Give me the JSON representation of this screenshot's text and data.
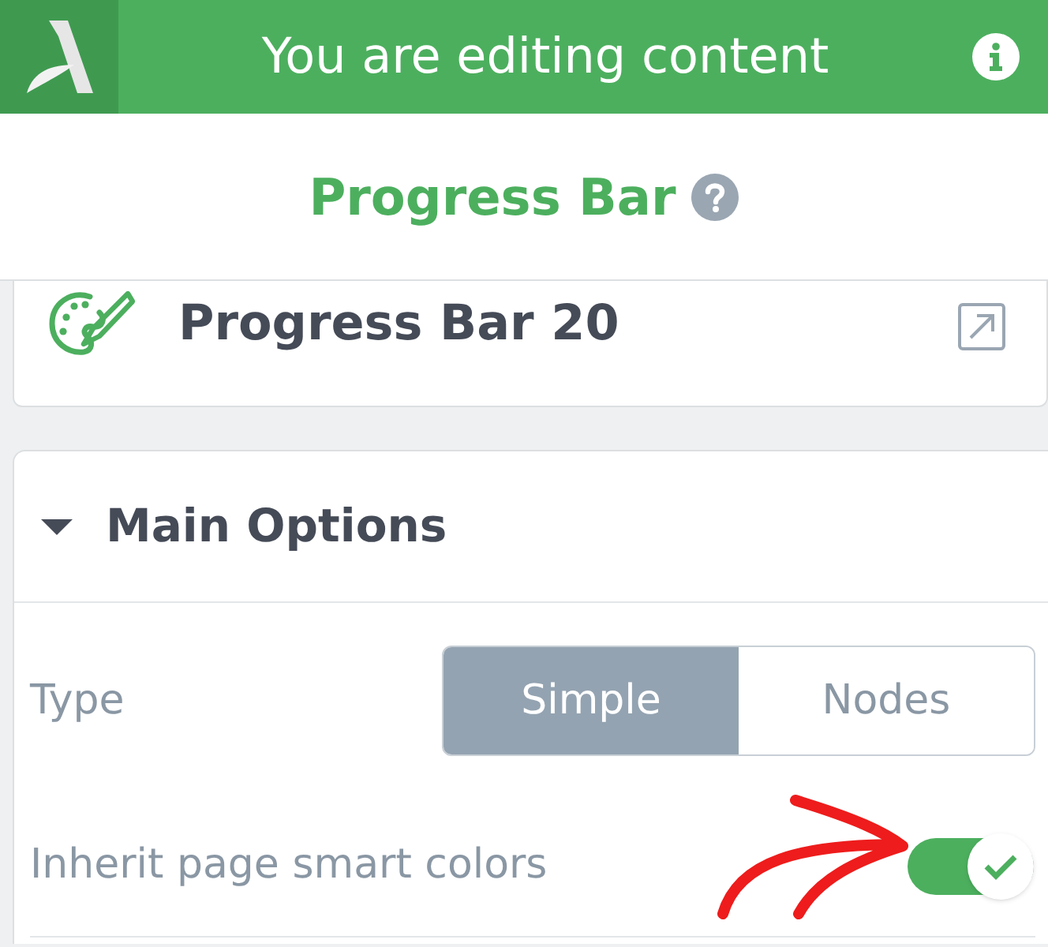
{
  "header": {
    "title": "You are editing content"
  },
  "panel": {
    "title": "Progress Bar"
  },
  "element": {
    "name": "Progress Bar 20"
  },
  "section": {
    "title": "Main Options",
    "expanded": true,
    "fields": [
      {
        "kind": "segmented",
        "label": "Type",
        "options": [
          {
            "label": "Simple",
            "selected": true
          },
          {
            "label": "Nodes",
            "selected": false
          }
        ]
      },
      {
        "kind": "toggle",
        "label": "Inherit page smart colors",
        "on": true
      }
    ]
  }
}
